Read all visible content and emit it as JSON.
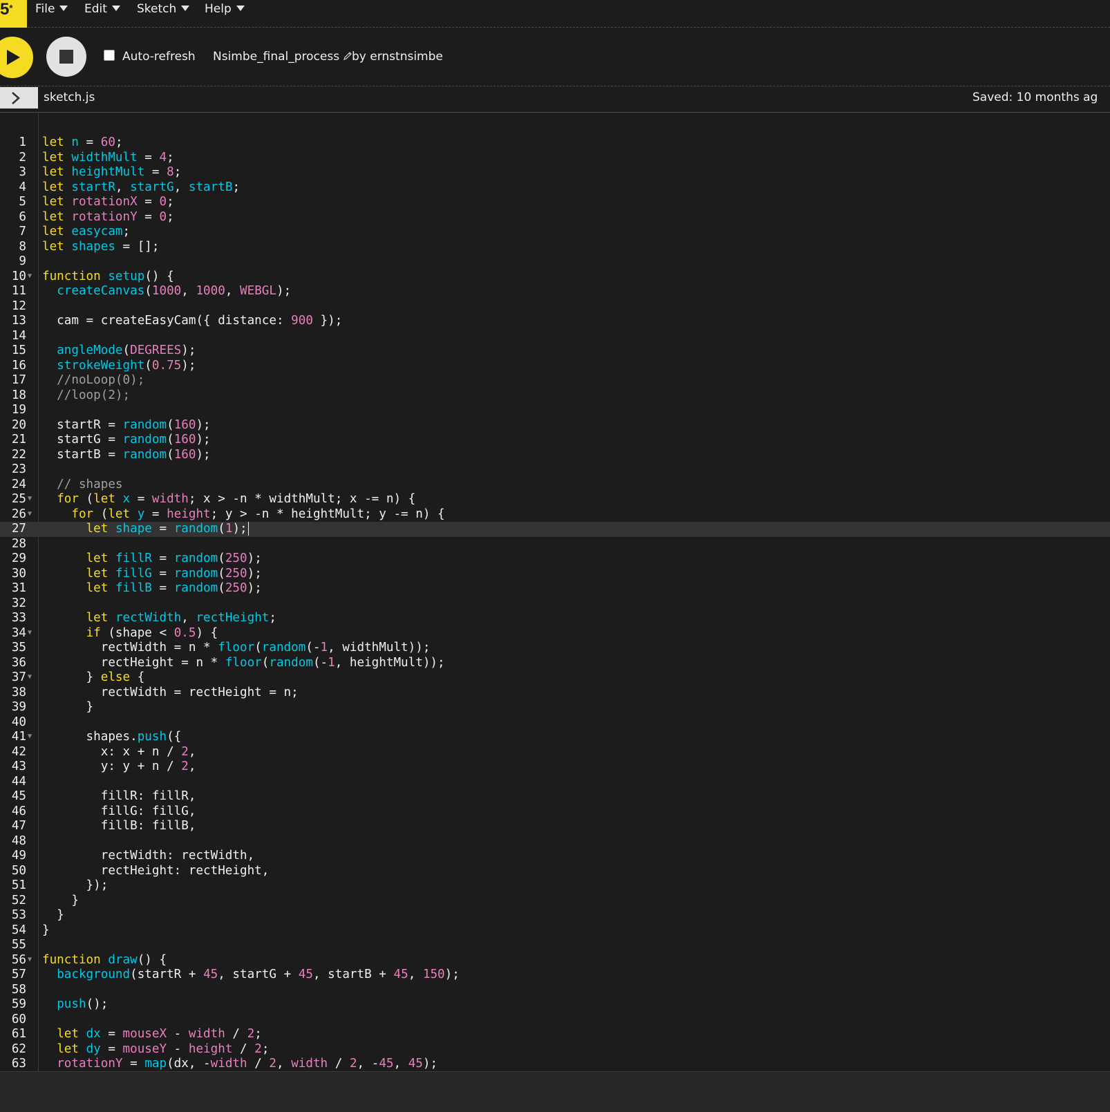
{
  "app": {
    "logo_text": "5",
    "logo_mark": "*",
    "menu": [
      {
        "label": "File"
      },
      {
        "label": "Edit"
      },
      {
        "label": "Sketch"
      },
      {
        "label": "Help"
      }
    ]
  },
  "toolbar": {
    "autorefresh_label": "Auto-refresh",
    "autorefresh_checked": false,
    "project_name": "Nsimbe_final_process",
    "owner_label": "by ernstnsimbe"
  },
  "file_tab": {
    "file_name": "sketch.js",
    "saved_status": "Saved: 10 months ag"
  },
  "editor": {
    "active_line": 27,
    "cursor_after_line": 27,
    "lines": [
      {
        "n": "1",
        "t": [
          [
            "kw",
            "let "
          ],
          [
            "var",
            "n"
          ],
          [
            "pl",
            " = "
          ],
          [
            "num",
            "60"
          ],
          [
            "pl",
            ";"
          ]
        ]
      },
      {
        "n": "2",
        "t": [
          [
            "kw",
            "let "
          ],
          [
            "var",
            "widthMult"
          ],
          [
            "pl",
            " = "
          ],
          [
            "num",
            "4"
          ],
          [
            "pl",
            ";"
          ]
        ]
      },
      {
        "n": "3",
        "t": [
          [
            "kw",
            "let "
          ],
          [
            "var",
            "heightMult"
          ],
          [
            "pl",
            " = "
          ],
          [
            "num",
            "8"
          ],
          [
            "pl",
            ";"
          ]
        ]
      },
      {
        "n": "4",
        "t": [
          [
            "kw",
            "let "
          ],
          [
            "var",
            "startR"
          ],
          [
            "pl",
            ", "
          ],
          [
            "var",
            "startG"
          ],
          [
            "pl",
            ", "
          ],
          [
            "var",
            "startB"
          ],
          [
            "pl",
            ";"
          ]
        ]
      },
      {
        "n": "5",
        "t": [
          [
            "kw",
            "let "
          ],
          [
            "num",
            "rotationX"
          ],
          [
            "pl",
            " = "
          ],
          [
            "num",
            "0"
          ],
          [
            "pl",
            ";"
          ]
        ]
      },
      {
        "n": "6",
        "t": [
          [
            "kw",
            "let "
          ],
          [
            "num",
            "rotationY"
          ],
          [
            "pl",
            " = "
          ],
          [
            "num",
            "0"
          ],
          [
            "pl",
            ";"
          ]
        ]
      },
      {
        "n": "7",
        "t": [
          [
            "kw",
            "let "
          ],
          [
            "var",
            "easycam"
          ],
          [
            "pl",
            ";"
          ]
        ]
      },
      {
        "n": "8",
        "t": [
          [
            "kw",
            "let "
          ],
          [
            "var",
            "shapes"
          ],
          [
            "pl",
            " = [];"
          ]
        ]
      },
      {
        "n": "9",
        "t": []
      },
      {
        "n": "10",
        "fold": true,
        "t": [
          [
            "kw",
            "function "
          ],
          [
            "fn",
            "setup"
          ],
          [
            "pl",
            "() {"
          ]
        ]
      },
      {
        "n": "11",
        "t": [
          [
            "pl",
            "  "
          ],
          [
            "fn",
            "createCanvas"
          ],
          [
            "pl",
            "("
          ],
          [
            "num",
            "1000"
          ],
          [
            "pl",
            ", "
          ],
          [
            "num",
            "1000"
          ],
          [
            "pl",
            ", "
          ],
          [
            "num",
            "WEBGL"
          ],
          [
            "pl",
            ");"
          ]
        ]
      },
      {
        "n": "12",
        "t": []
      },
      {
        "n": "13",
        "t": [
          [
            "pl",
            "  cam = createEasyCam({ distance: "
          ],
          [
            "num",
            "900"
          ],
          [
            "pl",
            " });"
          ]
        ]
      },
      {
        "n": "14",
        "t": []
      },
      {
        "n": "15",
        "t": [
          [
            "pl",
            "  "
          ],
          [
            "fn",
            "angleMode"
          ],
          [
            "pl",
            "("
          ],
          [
            "num",
            "DEGREES"
          ],
          [
            "pl",
            ");"
          ]
        ]
      },
      {
        "n": "16",
        "t": [
          [
            "pl",
            "  "
          ],
          [
            "fn",
            "strokeWeight"
          ],
          [
            "pl",
            "("
          ],
          [
            "num",
            "0.75"
          ],
          [
            "pl",
            ");"
          ]
        ]
      },
      {
        "n": "17",
        "t": [
          [
            "cm",
            "  //noLoop(0);"
          ]
        ]
      },
      {
        "n": "18",
        "t": [
          [
            "cm",
            "  //loop(2);"
          ]
        ]
      },
      {
        "n": "19",
        "t": []
      },
      {
        "n": "20",
        "t": [
          [
            "pl",
            "  startR = "
          ],
          [
            "fn",
            "random"
          ],
          [
            "pl",
            "("
          ],
          [
            "num",
            "160"
          ],
          [
            "pl",
            ");"
          ]
        ]
      },
      {
        "n": "21",
        "t": [
          [
            "pl",
            "  startG = "
          ],
          [
            "fn",
            "random"
          ],
          [
            "pl",
            "("
          ],
          [
            "num",
            "160"
          ],
          [
            "pl",
            ");"
          ]
        ]
      },
      {
        "n": "22",
        "t": [
          [
            "pl",
            "  startB = "
          ],
          [
            "fn",
            "random"
          ],
          [
            "pl",
            "("
          ],
          [
            "num",
            "160"
          ],
          [
            "pl",
            ");"
          ]
        ]
      },
      {
        "n": "23",
        "t": []
      },
      {
        "n": "24",
        "t": [
          [
            "cm",
            "  // shapes"
          ]
        ]
      },
      {
        "n": "25",
        "fold": true,
        "t": [
          [
            "pl",
            "  "
          ],
          [
            "kw",
            "for"
          ],
          [
            "pl",
            " ("
          ],
          [
            "kw",
            "let "
          ],
          [
            "var",
            "x"
          ],
          [
            "pl",
            " = "
          ],
          [
            "num",
            "width"
          ],
          [
            "pl",
            "; x > -n * widthMult; x -= n) {"
          ]
        ]
      },
      {
        "n": "26",
        "fold": true,
        "t": [
          [
            "pl",
            "    "
          ],
          [
            "kw",
            "for"
          ],
          [
            "pl",
            " ("
          ],
          [
            "kw",
            "let "
          ],
          [
            "var",
            "y"
          ],
          [
            "pl",
            " = "
          ],
          [
            "num",
            "height"
          ],
          [
            "pl",
            "; y > -n * heightMult; y -= n) {"
          ]
        ]
      },
      {
        "n": "27",
        "t": [
          [
            "pl",
            "      "
          ],
          [
            "kw",
            "let "
          ],
          [
            "var",
            "shape"
          ],
          [
            "pl",
            " = "
          ],
          [
            "fn",
            "random"
          ],
          [
            "pl",
            "("
          ],
          [
            "num",
            "1"
          ],
          [
            "pl",
            ");"
          ]
        ]
      },
      {
        "n": "28",
        "t": []
      },
      {
        "n": "29",
        "t": [
          [
            "pl",
            "      "
          ],
          [
            "kw",
            "let "
          ],
          [
            "var",
            "fillR"
          ],
          [
            "pl",
            " = "
          ],
          [
            "fn",
            "random"
          ],
          [
            "pl",
            "("
          ],
          [
            "num",
            "250"
          ],
          [
            "pl",
            ");"
          ]
        ]
      },
      {
        "n": "30",
        "t": [
          [
            "pl",
            "      "
          ],
          [
            "kw",
            "let "
          ],
          [
            "var",
            "fillG"
          ],
          [
            "pl",
            " = "
          ],
          [
            "fn",
            "random"
          ],
          [
            "pl",
            "("
          ],
          [
            "num",
            "250"
          ],
          [
            "pl",
            ");"
          ]
        ]
      },
      {
        "n": "31",
        "t": [
          [
            "pl",
            "      "
          ],
          [
            "kw",
            "let "
          ],
          [
            "var",
            "fillB"
          ],
          [
            "pl",
            " = "
          ],
          [
            "fn",
            "random"
          ],
          [
            "pl",
            "("
          ],
          [
            "num",
            "250"
          ],
          [
            "pl",
            ");"
          ]
        ]
      },
      {
        "n": "32",
        "t": []
      },
      {
        "n": "33",
        "t": [
          [
            "pl",
            "      "
          ],
          [
            "kw",
            "let "
          ],
          [
            "var",
            "rectWidth"
          ],
          [
            "pl",
            ", "
          ],
          [
            "var",
            "rectHeight"
          ],
          [
            "pl",
            ";"
          ]
        ]
      },
      {
        "n": "34",
        "fold": true,
        "t": [
          [
            "pl",
            "      "
          ],
          [
            "kw",
            "if"
          ],
          [
            "pl",
            " (shape < "
          ],
          [
            "num",
            "0.5"
          ],
          [
            "pl",
            ") {"
          ]
        ]
      },
      {
        "n": "35",
        "t": [
          [
            "pl",
            "        rectWidth = n * "
          ],
          [
            "fn",
            "floor"
          ],
          [
            "pl",
            "("
          ],
          [
            "fn",
            "random"
          ],
          [
            "pl",
            "(-"
          ],
          [
            "num",
            "1"
          ],
          [
            "pl",
            ", widthMult));"
          ]
        ]
      },
      {
        "n": "36",
        "t": [
          [
            "pl",
            "        rectHeight = n * "
          ],
          [
            "fn",
            "floor"
          ],
          [
            "pl",
            "("
          ],
          [
            "fn",
            "random"
          ],
          [
            "pl",
            "(-"
          ],
          [
            "num",
            "1"
          ],
          [
            "pl",
            ", heightMult));"
          ]
        ]
      },
      {
        "n": "37",
        "fold": true,
        "t": [
          [
            "pl",
            "      } "
          ],
          [
            "kw",
            "else"
          ],
          [
            "pl",
            " {"
          ]
        ]
      },
      {
        "n": "38",
        "t": [
          [
            "pl",
            "        rectWidth = rectHeight = n;"
          ]
        ]
      },
      {
        "n": "39",
        "t": [
          [
            "pl",
            "      }"
          ]
        ]
      },
      {
        "n": "40",
        "t": []
      },
      {
        "n": "41",
        "fold": true,
        "t": [
          [
            "pl",
            "      shapes."
          ],
          [
            "fn",
            "push"
          ],
          [
            "pl",
            "({"
          ]
        ]
      },
      {
        "n": "42",
        "t": [
          [
            "pl",
            "        x: x + n / "
          ],
          [
            "num",
            "2"
          ],
          [
            "pl",
            ","
          ]
        ]
      },
      {
        "n": "43",
        "t": [
          [
            "pl",
            "        y: y + n / "
          ],
          [
            "num",
            "2"
          ],
          [
            "pl",
            ","
          ]
        ]
      },
      {
        "n": "44",
        "t": []
      },
      {
        "n": "45",
        "t": [
          [
            "pl",
            "        fillR: fillR,"
          ]
        ]
      },
      {
        "n": "46",
        "t": [
          [
            "pl",
            "        fillG: fillG,"
          ]
        ]
      },
      {
        "n": "47",
        "t": [
          [
            "pl",
            "        fillB: fillB,"
          ]
        ]
      },
      {
        "n": "48",
        "t": []
      },
      {
        "n": "49",
        "t": [
          [
            "pl",
            "        rectWidth: rectWidth,"
          ]
        ]
      },
      {
        "n": "50",
        "t": [
          [
            "pl",
            "        rectHeight: rectHeight,"
          ]
        ]
      },
      {
        "n": "51",
        "t": [
          [
            "pl",
            "      });"
          ]
        ]
      },
      {
        "n": "52",
        "t": [
          [
            "pl",
            "    }"
          ]
        ]
      },
      {
        "n": "53",
        "t": [
          [
            "pl",
            "  }"
          ]
        ]
      },
      {
        "n": "54",
        "t": [
          [
            "pl",
            "}"
          ]
        ]
      },
      {
        "n": "55",
        "t": []
      },
      {
        "n": "56",
        "fold": true,
        "t": [
          [
            "kw",
            "function "
          ],
          [
            "fn",
            "draw"
          ],
          [
            "pl",
            "() {"
          ]
        ]
      },
      {
        "n": "57",
        "t": [
          [
            "pl",
            "  "
          ],
          [
            "fn",
            "background"
          ],
          [
            "pl",
            "(startR + "
          ],
          [
            "num",
            "45"
          ],
          [
            "pl",
            ", startG + "
          ],
          [
            "num",
            "45"
          ],
          [
            "pl",
            ", startB + "
          ],
          [
            "num",
            "45"
          ],
          [
            "pl",
            ", "
          ],
          [
            "num",
            "150"
          ],
          [
            "pl",
            ");"
          ]
        ]
      },
      {
        "n": "58",
        "t": []
      },
      {
        "n": "59",
        "t": [
          [
            "pl",
            "  "
          ],
          [
            "fn",
            "push"
          ],
          [
            "pl",
            "();"
          ]
        ]
      },
      {
        "n": "60",
        "t": []
      },
      {
        "n": "61",
        "t": [
          [
            "pl",
            "  "
          ],
          [
            "kw",
            "let "
          ],
          [
            "var",
            "dx"
          ],
          [
            "pl",
            " = "
          ],
          [
            "num",
            "mouseX"
          ],
          [
            "pl",
            " - "
          ],
          [
            "num",
            "width"
          ],
          [
            "pl",
            " / "
          ],
          [
            "num",
            "2"
          ],
          [
            "pl",
            ";"
          ]
        ]
      },
      {
        "n": "62",
        "t": [
          [
            "pl",
            "  "
          ],
          [
            "kw",
            "let "
          ],
          [
            "var",
            "dy"
          ],
          [
            "pl",
            " = "
          ],
          [
            "num",
            "mouseY"
          ],
          [
            "pl",
            " - "
          ],
          [
            "num",
            "height"
          ],
          [
            "pl",
            " / "
          ],
          [
            "num",
            "2"
          ],
          [
            "pl",
            ";"
          ]
        ]
      },
      {
        "n": "63",
        "t": [
          [
            "pl",
            "  "
          ],
          [
            "num",
            "rotationY"
          ],
          [
            "pl",
            " = "
          ],
          [
            "fn",
            "map"
          ],
          [
            "pl",
            "(dx, -"
          ],
          [
            "num",
            "width"
          ],
          [
            "pl",
            " / "
          ],
          [
            "num",
            "2"
          ],
          [
            "pl",
            ", "
          ],
          [
            "num",
            "width"
          ],
          [
            "pl",
            " / "
          ],
          [
            "num",
            "2"
          ],
          [
            "pl",
            ", -"
          ],
          [
            "num",
            "45"
          ],
          [
            "pl",
            ", "
          ],
          [
            "num",
            "45"
          ],
          [
            "pl",
            ");"
          ]
        ]
      }
    ]
  },
  "colors": {
    "background": "#1c1c1c",
    "accent": "#f5dc23",
    "keyword": "#f5dc23",
    "identifier": "#00c9e6",
    "number": "#ea7fbf",
    "comment": "#a0a0a0"
  }
}
